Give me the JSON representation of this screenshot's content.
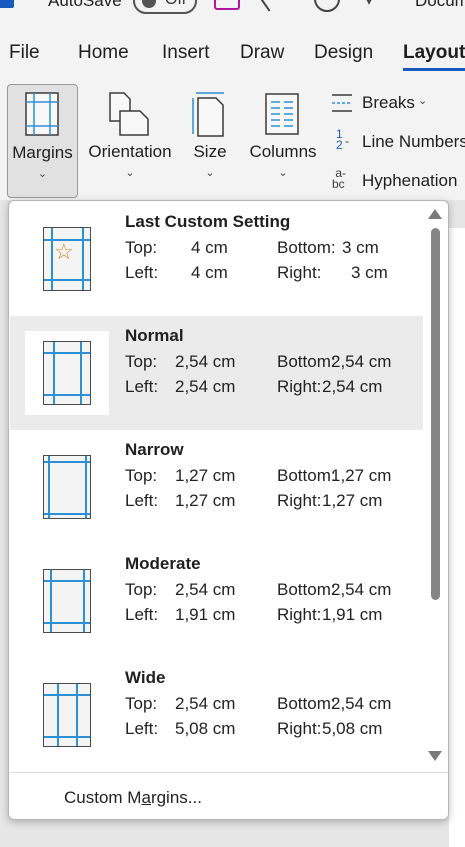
{
  "titlebar": {
    "autosave_label": "AutoSave",
    "toggle_state": "Off",
    "document_name": "Docum"
  },
  "tabs": [
    {
      "label": "File"
    },
    {
      "label": "Home"
    },
    {
      "label": "Insert"
    },
    {
      "label": "Draw"
    },
    {
      "label": "Design"
    },
    {
      "label": "Layout",
      "active": true
    }
  ],
  "ribbon": {
    "margins": "Margins",
    "orientation": "Orientation",
    "size": "Size",
    "columns": "Columns",
    "breaks": "Breaks",
    "line_numbers": "Line Numbers",
    "hyphenation": "Hyphenation"
  },
  "margins_menu": {
    "items": [
      {
        "title": "Last Custom Setting",
        "top_label": "Top:",
        "top": "4 cm",
        "bottom_label": "Bottom:",
        "bottom": "3 cm",
        "left_label": "Left:",
        "left": "4 cm",
        "right_label": "Right:",
        "right": "3 cm",
        "icon": "custom-star-icon"
      },
      {
        "title": "Normal",
        "top_label": "Top:",
        "top": "2,54 cm",
        "bottom_label": "Bottom:",
        "bottom": "2,54 cm",
        "left_label": "Left:",
        "left": "2,54 cm",
        "right_label": "Right:",
        "right": "2,54 cm",
        "selected": true
      },
      {
        "title": "Narrow",
        "top_label": "Top:",
        "top": "1,27 cm",
        "bottom_label": "Bottom:",
        "bottom": "1,27 cm",
        "left_label": "Left:",
        "left": "1,27 cm",
        "right_label": "Right:",
        "right": "1,27 cm"
      },
      {
        "title": "Moderate",
        "top_label": "Top:",
        "top": "2,54 cm",
        "bottom_label": "Bottom:",
        "bottom": "2,54 cm",
        "left_label": "Left:",
        "left": "1,91 cm",
        "right_label": "Right:",
        "right": "1,91 cm"
      },
      {
        "title": "Wide",
        "top_label": "Top:",
        "top": "2,54 cm",
        "bottom_label": "Bottom:",
        "bottom": "2,54 cm",
        "left_label": "Left:",
        "left": "5,08 cm",
        "right_label": "Right:",
        "right": "5,08 cm"
      }
    ],
    "custom_margins_prefix": "Custom M",
    "custom_margins_accel": "a",
    "custom_margins_suffix": "rgins..."
  },
  "colors": {
    "accent": "#185abd",
    "guide_blue": "#2d8fd6",
    "selected_bg": "#ebebeb",
    "star": "#d08a2c",
    "save_icon": "#b4179c"
  }
}
